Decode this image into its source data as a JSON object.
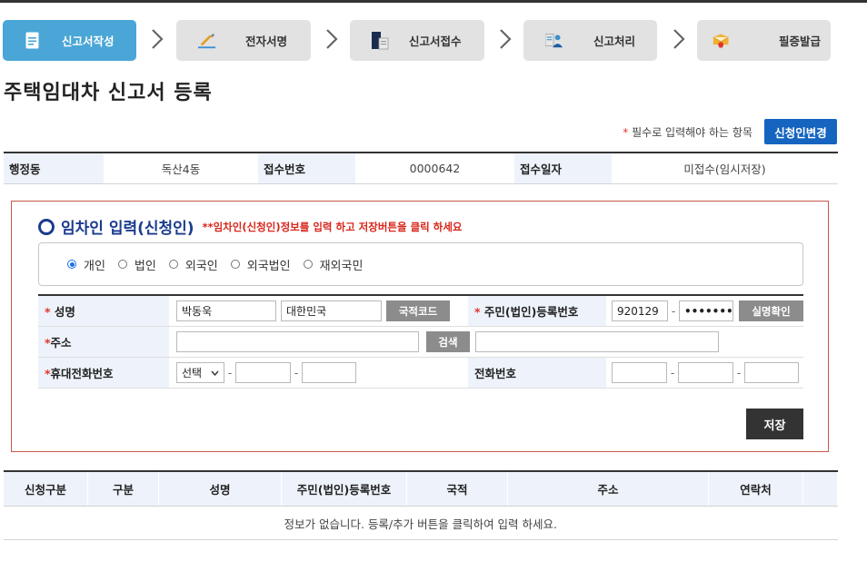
{
  "steps": [
    {
      "label": "신고서작성",
      "icon": "document-icon",
      "active": true
    },
    {
      "label": "전자서명",
      "icon": "pen-icon",
      "active": false
    },
    {
      "label": "신고서접수",
      "icon": "folder-icon",
      "active": false
    },
    {
      "label": "신고처리",
      "icon": "person-document-icon",
      "active": false
    },
    {
      "label": "필증발급",
      "icon": "envelope-icon",
      "active": false
    }
  ],
  "page_title": "주택임대차 신고서 등록",
  "required_note": {
    "star": "*",
    "text": " 필수로 입력해야 하는 항목"
  },
  "change_applicant_button": "신청인변경",
  "info": {
    "dong_label": "행정동",
    "dong_value": "독산4동",
    "receipt_no_label": "접수번호",
    "receipt_no_value": "0000642",
    "receipt_date_label": "접수일자",
    "receipt_date_value": "미접수(임시저장)"
  },
  "tenant": {
    "title": "임차인 입력(신청인)",
    "notice": "**임차인(신청인)정보를 입력 하고 저장버튼을 클릭 하세요",
    "types": [
      "개인",
      "법인",
      "외국인",
      "외국법인",
      "재외국민"
    ],
    "selected_type": "개인",
    "name_label": "성명",
    "name_value": "박동욱",
    "nationality_value": "대한민국",
    "nationality_code_button": "국적코드",
    "rrn_label": "주민(법인)등록번호",
    "rrn_front": "920129",
    "rrn_back": "•••••••",
    "verify_button": "실명확인",
    "address_label": "주소",
    "address_value": "",
    "search_button": "검색",
    "address_detail": "",
    "mobile_label": "휴대전화번호",
    "mobile_select": "선택",
    "mobile_mid": "",
    "mobile_last": "",
    "phone_label": "전화번호",
    "phone_1": "",
    "phone_2": "",
    "phone_3": "",
    "required_star": "*",
    "dash": "-"
  },
  "save_button": "저장",
  "list": {
    "headers": [
      "신청구분",
      "구분",
      "성명",
      "주민(법인)등록번호",
      "국적",
      "주소",
      "연락처",
      ""
    ],
    "empty_message": "정보가 없습니다.  등록/추가 버튼을 클릭하여 입력 하세요."
  },
  "colors": {
    "active_step": "#4aa6d6",
    "primary_button": "#1565c0",
    "required": "#e0352b",
    "section_title": "#1a3b8e",
    "notice": "#d9261c",
    "box_border": "#c9584d"
  }
}
